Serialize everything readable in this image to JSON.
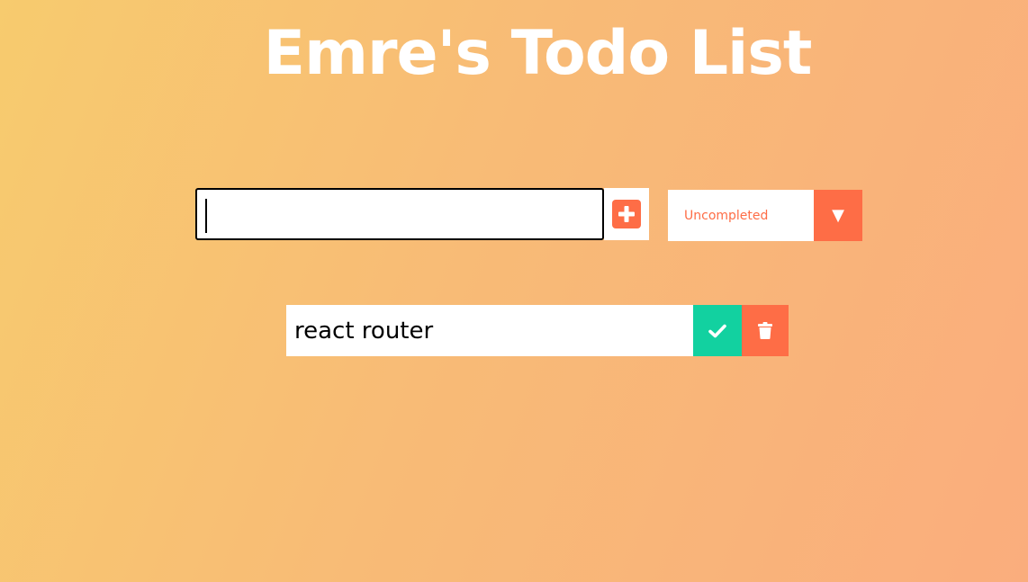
{
  "header": {
    "title": "Emre's Todo List"
  },
  "form": {
    "input_value": "",
    "add_icon": "plus-square-icon",
    "filter": {
      "selected": "Uncompleted",
      "arrow_icon": "caret-down-icon"
    }
  },
  "todos": [
    {
      "text": "react router",
      "complete_icon": "check-icon",
      "delete_icon": "trash-icon"
    }
  ],
  "colors": {
    "accent": "#fe6d46",
    "complete": "#12d1a0",
    "title": "#ffffff"
  }
}
